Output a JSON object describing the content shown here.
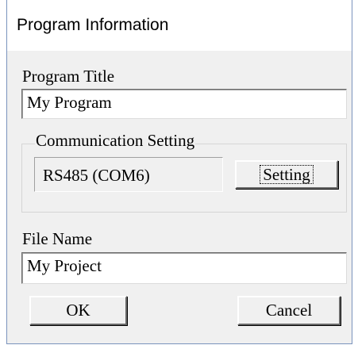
{
  "window": {
    "title": "Program Information"
  },
  "program_title": {
    "label": "Program Title",
    "value": "My Program"
  },
  "communication": {
    "group_label": "Communication Setting",
    "value": "RS485 (COM6)",
    "setting_button": "Setting"
  },
  "file_name": {
    "label": "File Name",
    "value": "My Project"
  },
  "buttons": {
    "ok": "OK",
    "cancel": "Cancel"
  }
}
